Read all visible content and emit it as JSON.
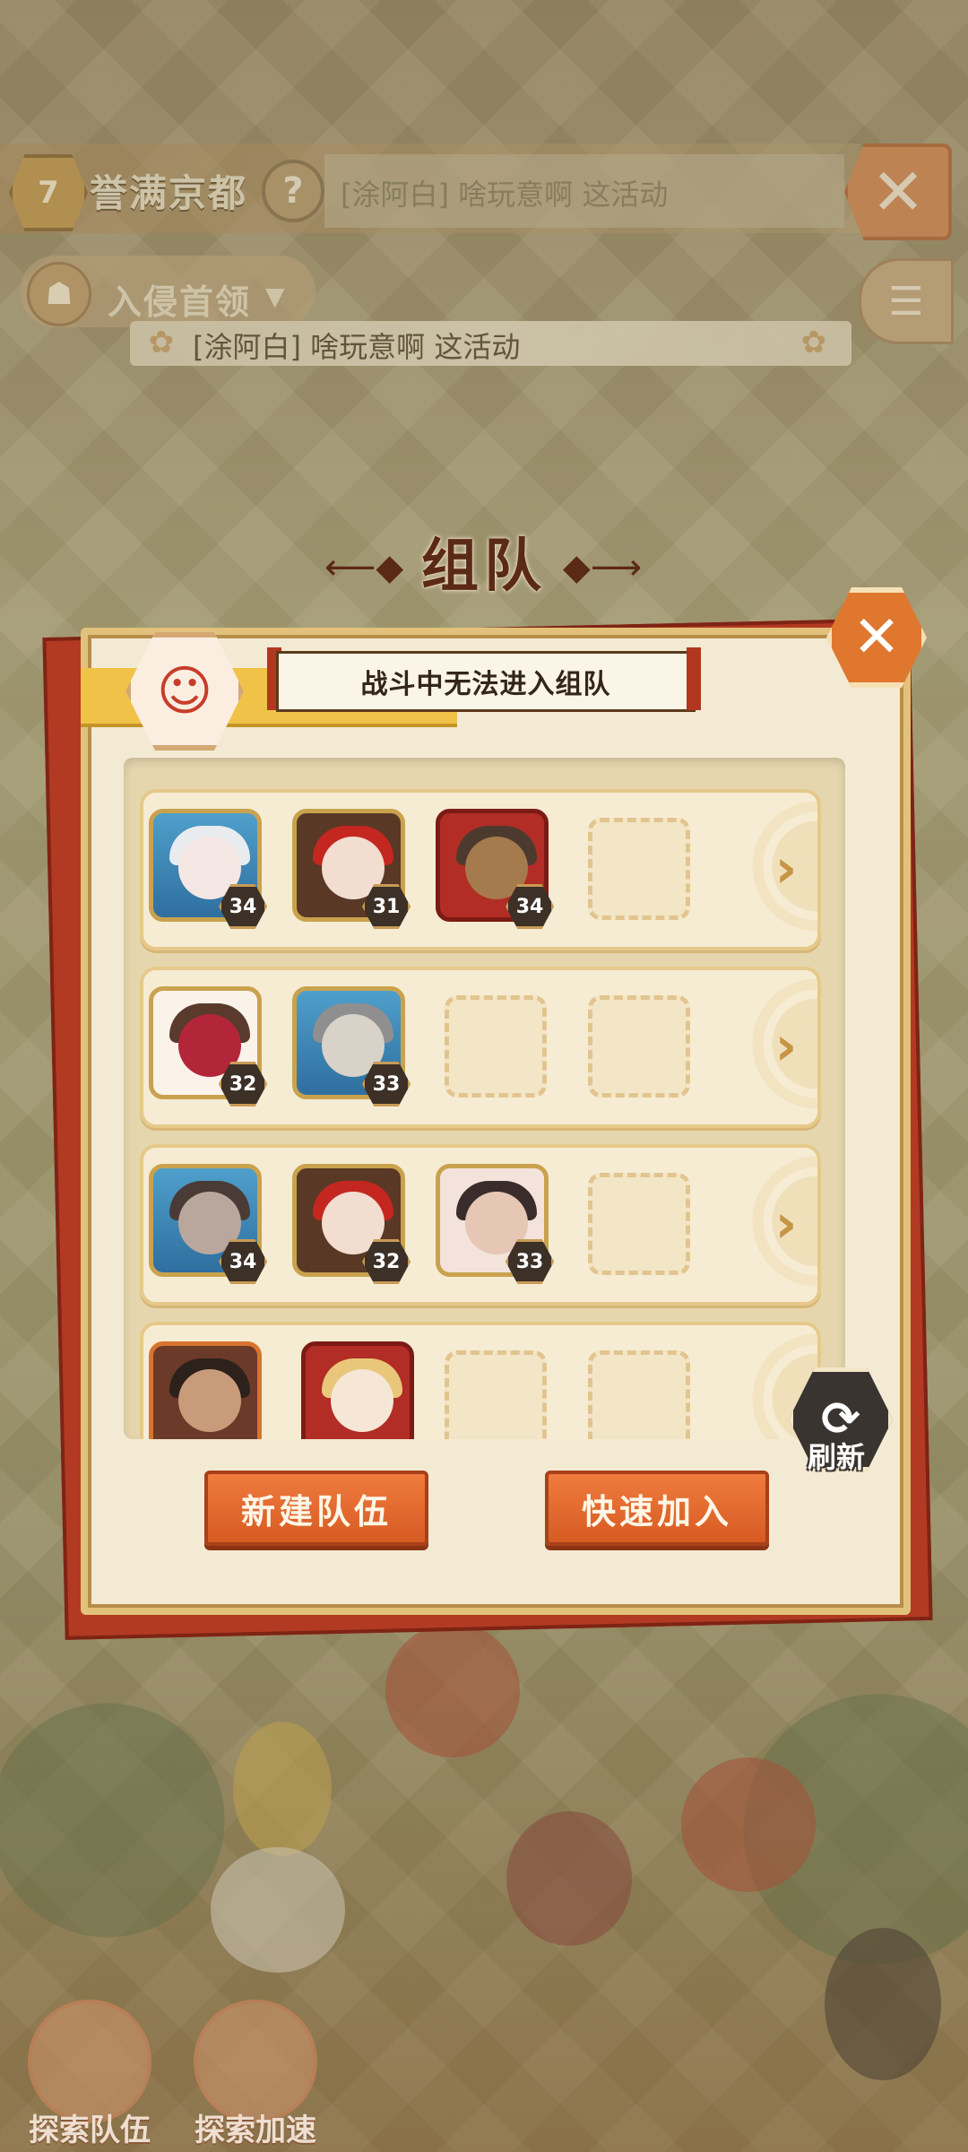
{
  "hud": {
    "level": "7",
    "region_name": "誉满京都",
    "help_icon": "?",
    "chat_message": "[涂阿白] 啥玩意啊 这活动",
    "close_icon": "✕",
    "boss_tab_label": "入侵首领",
    "list_icon": "☰"
  },
  "announcement": {
    "text": "[涂阿白] 啥玩意啊 这活动"
  },
  "dialog": {
    "title": "组队",
    "close_icon": "✕",
    "warning": "战斗中无法进入组队",
    "refresh_label": "刷新",
    "new_team_button": "新建队伍",
    "quick_join_button": "快速加入"
  },
  "teams": [
    {
      "members": [
        {
          "level": "34"
        },
        {
          "level": "31"
        },
        {
          "level": "34"
        }
      ],
      "empty_slots": 1
    },
    {
      "members": [
        {
          "level": "32"
        },
        {
          "level": "33"
        }
      ],
      "empty_slots": 2
    },
    {
      "members": [
        {
          "level": "34"
        },
        {
          "level": "32"
        },
        {
          "level": "33"
        }
      ],
      "empty_slots": 1
    },
    {
      "members": [
        {
          "level": ""
        },
        {
          "level": ""
        }
      ],
      "empty_slots": 2
    }
  ],
  "bottom_bar": {
    "explore_team": "探索队伍",
    "explore_speed": "探索加速"
  },
  "colors": {
    "accent_orange": "#e0772f",
    "frame_red": "#b23a22",
    "panel_cream": "#f3ead4"
  }
}
